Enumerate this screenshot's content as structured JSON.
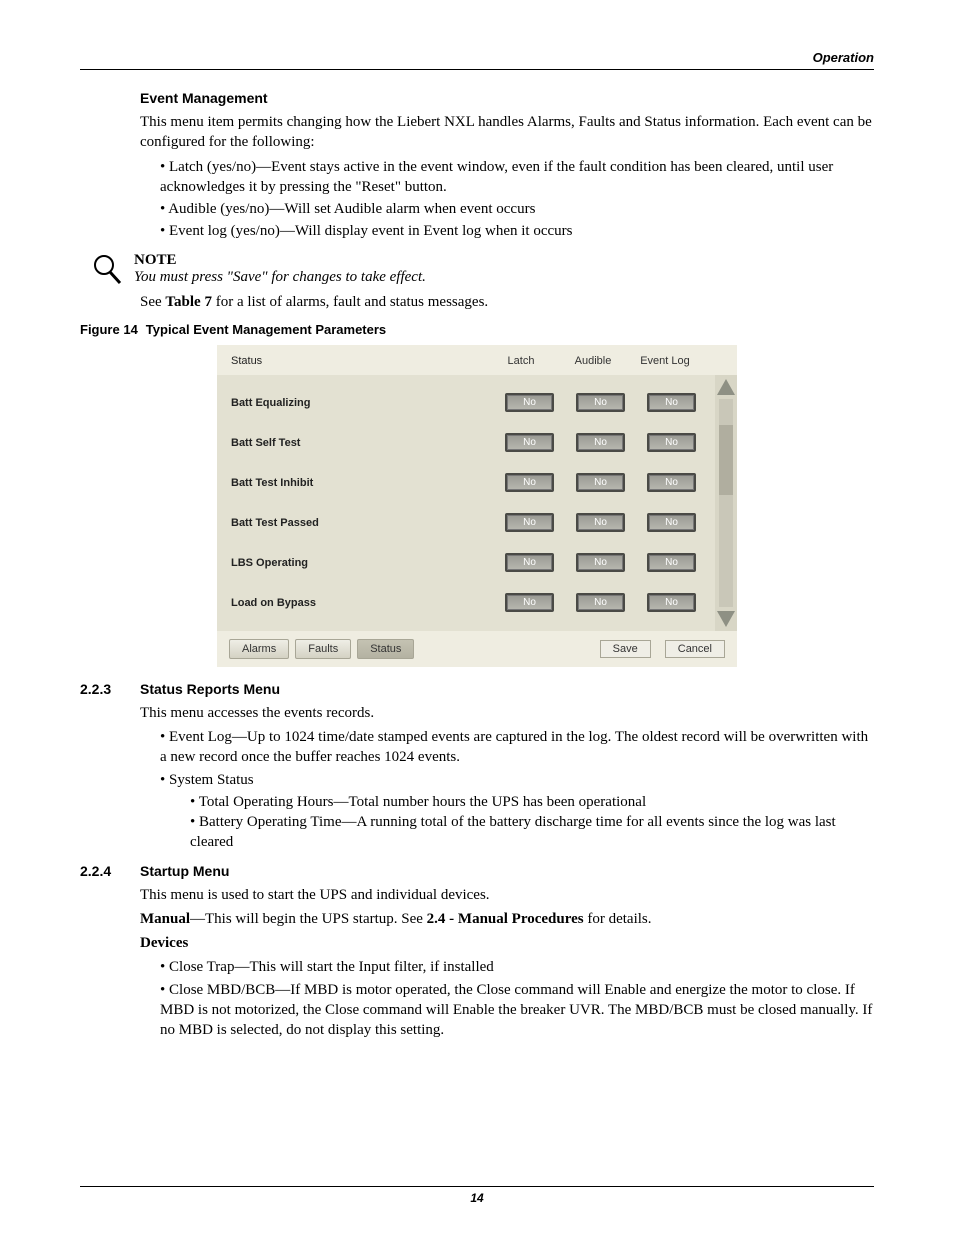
{
  "running_head": "Operation",
  "h1": "Event Management",
  "p1": "This menu item permits changing how the Liebert NXL handles Alarms, Faults and Status information. Each event can be configured for the following:",
  "bullets1": [
    "Latch (yes/no)—Event stays active in the event window, even if the fault condition has been cleared, until user acknowledges it by pressing the \"Reset\" button.",
    "Audible (yes/no)—Will set Audible alarm when event occurs",
    "Event log (yes/no)—Will display event in Event log when it occurs"
  ],
  "note": {
    "label": "NOTE",
    "body": "You must press \"Save\" for changes to take effect."
  },
  "p2_prefix": "See ",
  "p2_bold": "Table 7",
  "p2_suffix": " for a list of alarms, fault and status messages.",
  "figure": {
    "num": "Figure 14",
    "title": "Typical Event Management Parameters"
  },
  "ui": {
    "columns": {
      "status": "Status",
      "latch": "Latch",
      "audible": "Audible",
      "eventlog": "Event Log"
    },
    "rows": [
      {
        "name": "Batt Equalizing",
        "latch": "No",
        "audible": "No",
        "eventlog": "No"
      },
      {
        "name": "Batt Self Test",
        "latch": "No",
        "audible": "No",
        "eventlog": "No"
      },
      {
        "name": "Batt Test Inhibit",
        "latch": "No",
        "audible": "No",
        "eventlog": "No"
      },
      {
        "name": "Batt Test Passed",
        "latch": "No",
        "audible": "No",
        "eventlog": "No"
      },
      {
        "name": "LBS Operating",
        "latch": "No",
        "audible": "No",
        "eventlog": "No"
      },
      {
        "name": "Load on Bypass",
        "latch": "No",
        "audible": "No",
        "eventlog": "No"
      }
    ],
    "tabs": {
      "alarms": "Alarms",
      "faults": "Faults",
      "status": "Status"
    },
    "buttons": {
      "save": "Save",
      "cancel": "Cancel"
    }
  },
  "sec223": {
    "num": "2.2.3",
    "title": "Status Reports Menu",
    "p": "This menu accesses the events records.",
    "bullets": [
      "Event Log—Up to 1024 time/date stamped events are captured in the log. The oldest record will be overwritten with a new record once the buffer reaches 1024 events.",
      "System Status"
    ],
    "sub": [
      "Total Operating Hours—Total number hours the UPS has been operational",
      "Battery Operating Time—A running total of the battery discharge time for all events since the log was last cleared"
    ]
  },
  "sec224": {
    "num": "2.2.4",
    "title": "Startup Menu",
    "p1": "This menu is used to start the UPS and individual devices.",
    "p2_bold": "Manual",
    "p2_mid": "—This will begin the UPS startup. See ",
    "p2_bold2": "2.4 - Manual Procedures",
    "p2_suffix": " for details.",
    "devices_label": "Devices",
    "bullets": [
      "Close Trap—This will start the Input filter, if installed",
      "Close MBD/BCB—If MBD is motor operated, the Close command will Enable and energize the motor to close. If MBD is not motorized, the Close command will Enable the breaker UVR. The MBD/BCB must be closed manually. If no MBD is selected, do not display this setting."
    ]
  },
  "page_number": "14"
}
